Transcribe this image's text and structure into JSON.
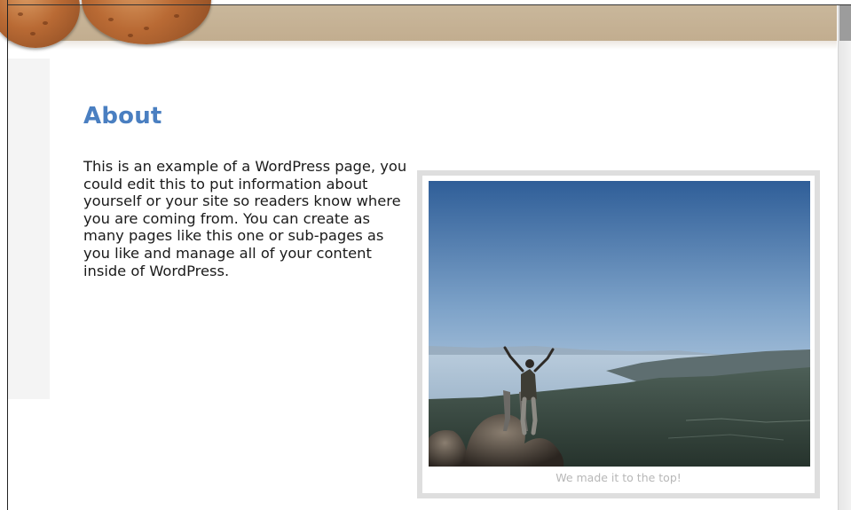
{
  "page": {
    "title": "About",
    "body": "This is an example of a WordPress page, you could edit this to put information about yourself or your site so readers know where you are coming from. You can create as many pages like this one or sub-pages as you like and manage all of your content inside of WordPress."
  },
  "photo": {
    "caption": "We made it to the top!"
  },
  "colors": {
    "title": "#4a7fc1",
    "header_band": "#c7b497",
    "frame_border": "#dedede",
    "caption": "#b7b7b7"
  }
}
